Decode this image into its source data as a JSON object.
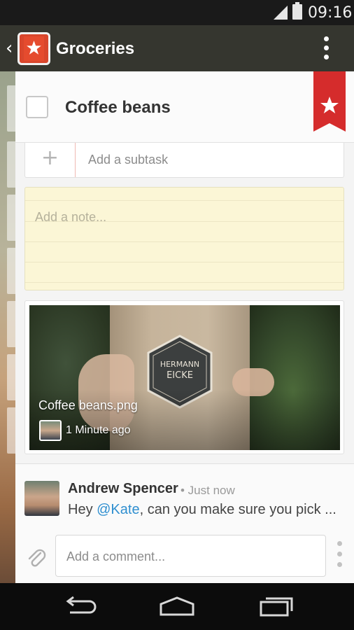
{
  "status_bar": {
    "time": "09:16",
    "signal_icon": "signal-icon",
    "battery_icon": "battery-icon"
  },
  "app_bar": {
    "back_icon": "chevron-left-icon",
    "logo_icon": "wunderlist-star-icon",
    "title": "Groceries",
    "menu_icon": "overflow-menu-icon"
  },
  "task": {
    "title": "Coffee beans",
    "starred": true,
    "colors": {
      "ribbon": "#d52c2c",
      "accent": "#2f8fd0"
    }
  },
  "subtask": {
    "placeholder": "Add a subtask"
  },
  "note": {
    "placeholder": "Add a note..."
  },
  "attachment": {
    "file_name": "Coffee beans.png",
    "time": "1 Minute ago",
    "hex_label_line1": "HERMANN",
    "hex_label_line2": "EICKE"
  },
  "comment": {
    "author": "Andrew Spencer",
    "meta": "• Just now",
    "text_before": "Hey ",
    "mention": "@Kate",
    "text_after": ", can you make sure you pick ..."
  },
  "comment_input": {
    "placeholder": "Add a comment..."
  },
  "nav_bar": {
    "back_icon": "nav-back-icon",
    "home_icon": "nav-home-icon",
    "recents_icon": "nav-recents-icon"
  }
}
